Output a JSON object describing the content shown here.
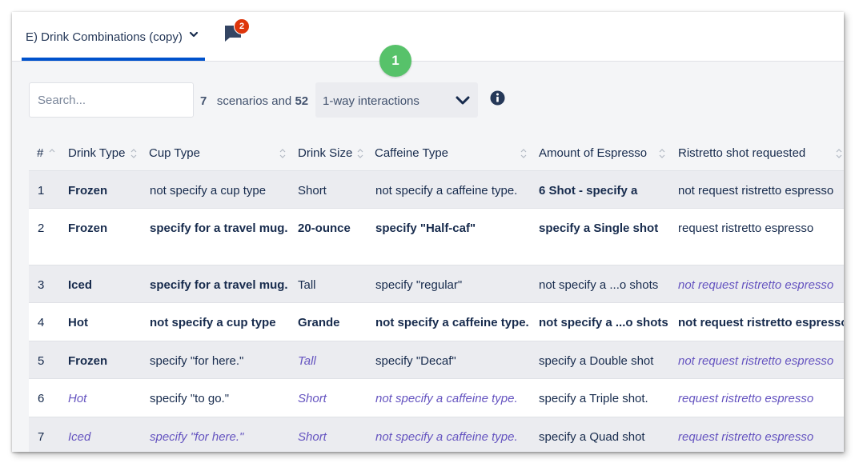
{
  "tab": {
    "label": "E) Drink Combinations (copy)"
  },
  "chat": {
    "badge": "2"
  },
  "step_marker": "1",
  "search": {
    "placeholder": "Search..."
  },
  "summary": {
    "scenarios": "7",
    "scenarios_text": "scenarios and",
    "interactions": "52"
  },
  "dropdown": {
    "selected": "1-way interactions"
  },
  "table": {
    "columns": [
      "#",
      "Drink Type",
      "Cup Type",
      "Drink Size",
      "Caffeine Type",
      "Amount of Espresso",
      "Ristretto shot requested"
    ],
    "rows": [
      {
        "num": "1",
        "drink_type": "Frozen",
        "cup_type": "not specify a cup type",
        "drink_size": "Short",
        "caffeine_type": "not specify a caffeine type.",
        "espresso": "6 Shot - specify a",
        "ristretto": "not request ristretto espresso"
      },
      {
        "num": "2",
        "drink_type": "Frozen",
        "cup_type": "specify for a travel mug.",
        "drink_size": "20-ounce",
        "caffeine_type": "specify \"Half-caf\"",
        "espresso": "specify a Single shot",
        "ristretto": "request ristretto espresso"
      },
      {
        "num": "3",
        "drink_type": "Iced",
        "cup_type": "specify for a travel mug.",
        "drink_size": "Tall",
        "caffeine_type": "specify \"regular\"",
        "espresso": "not specify a ...o shots",
        "ristretto": "not request ristretto espresso"
      },
      {
        "num": "4",
        "drink_type": "Hot",
        "cup_type": "not specify a cup type",
        "drink_size": "Grande",
        "caffeine_type": "not specify a caffeine type.",
        "espresso": "not specify a ...o shots",
        "ristretto": "not request ristretto espresso"
      },
      {
        "num": "5",
        "drink_type": "Frozen",
        "cup_type": "specify \"for here.\"",
        "drink_size": "Tall",
        "caffeine_type": "specify \"Decaf\"",
        "espresso": "specify a Double shot",
        "ristretto": "not request ristretto espresso"
      },
      {
        "num": "6",
        "drink_type": "Hot",
        "cup_type": "specify \"to go.\"",
        "drink_size": "Short",
        "caffeine_type": "not specify a caffeine type.",
        "espresso": "specify a Triple shot.",
        "ristretto": "request ristretto espresso"
      },
      {
        "num": "7",
        "drink_type": "Iced",
        "cup_type": "specify \"for here.\"",
        "drink_size": "Short",
        "caffeine_type": "not specify a caffeine type.",
        "espresso": "specify a Quad shot",
        "ristretto": "request ristretto espresso"
      }
    ]
  },
  "colors": {
    "accent": "#0052cc",
    "marker": "#57c26a",
    "badge": "#de350b",
    "italic_text": "#6554c0"
  }
}
